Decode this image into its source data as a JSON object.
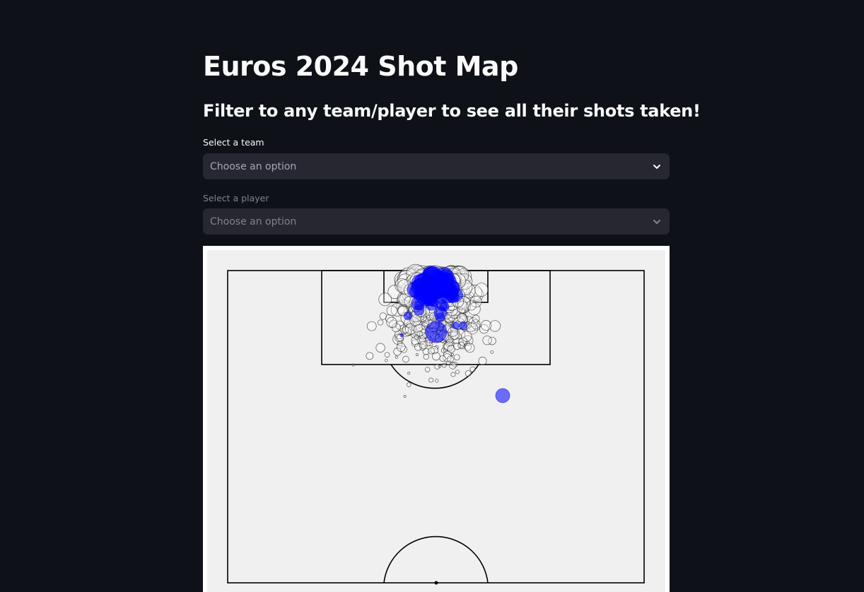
{
  "page": {
    "title": "Euros 2024 Shot Map",
    "subtitle": "Filter to any team/player to see all their shots taken!"
  },
  "filters": {
    "team": {
      "label": "Select a team",
      "placeholder": "Choose an option",
      "icon": "chevron-down-icon",
      "enabled": true
    },
    "player": {
      "label": "Select a player",
      "placeholder": "Choose an option",
      "icon": "chevron-down-icon",
      "enabled": false
    }
  },
  "chart_data": {
    "type": "scatter",
    "pitch": "half-pitch vertical, attacking upwards",
    "background": "#f0f0f0",
    "line_color": "#000000",
    "series": [
      {
        "name": "",
        "color": "#ffffff",
        "edge": "#000000"
      },
      {
        "name": "",
        "color": "#0000ff",
        "edge": "#0000ff"
      }
    ]
  }
}
